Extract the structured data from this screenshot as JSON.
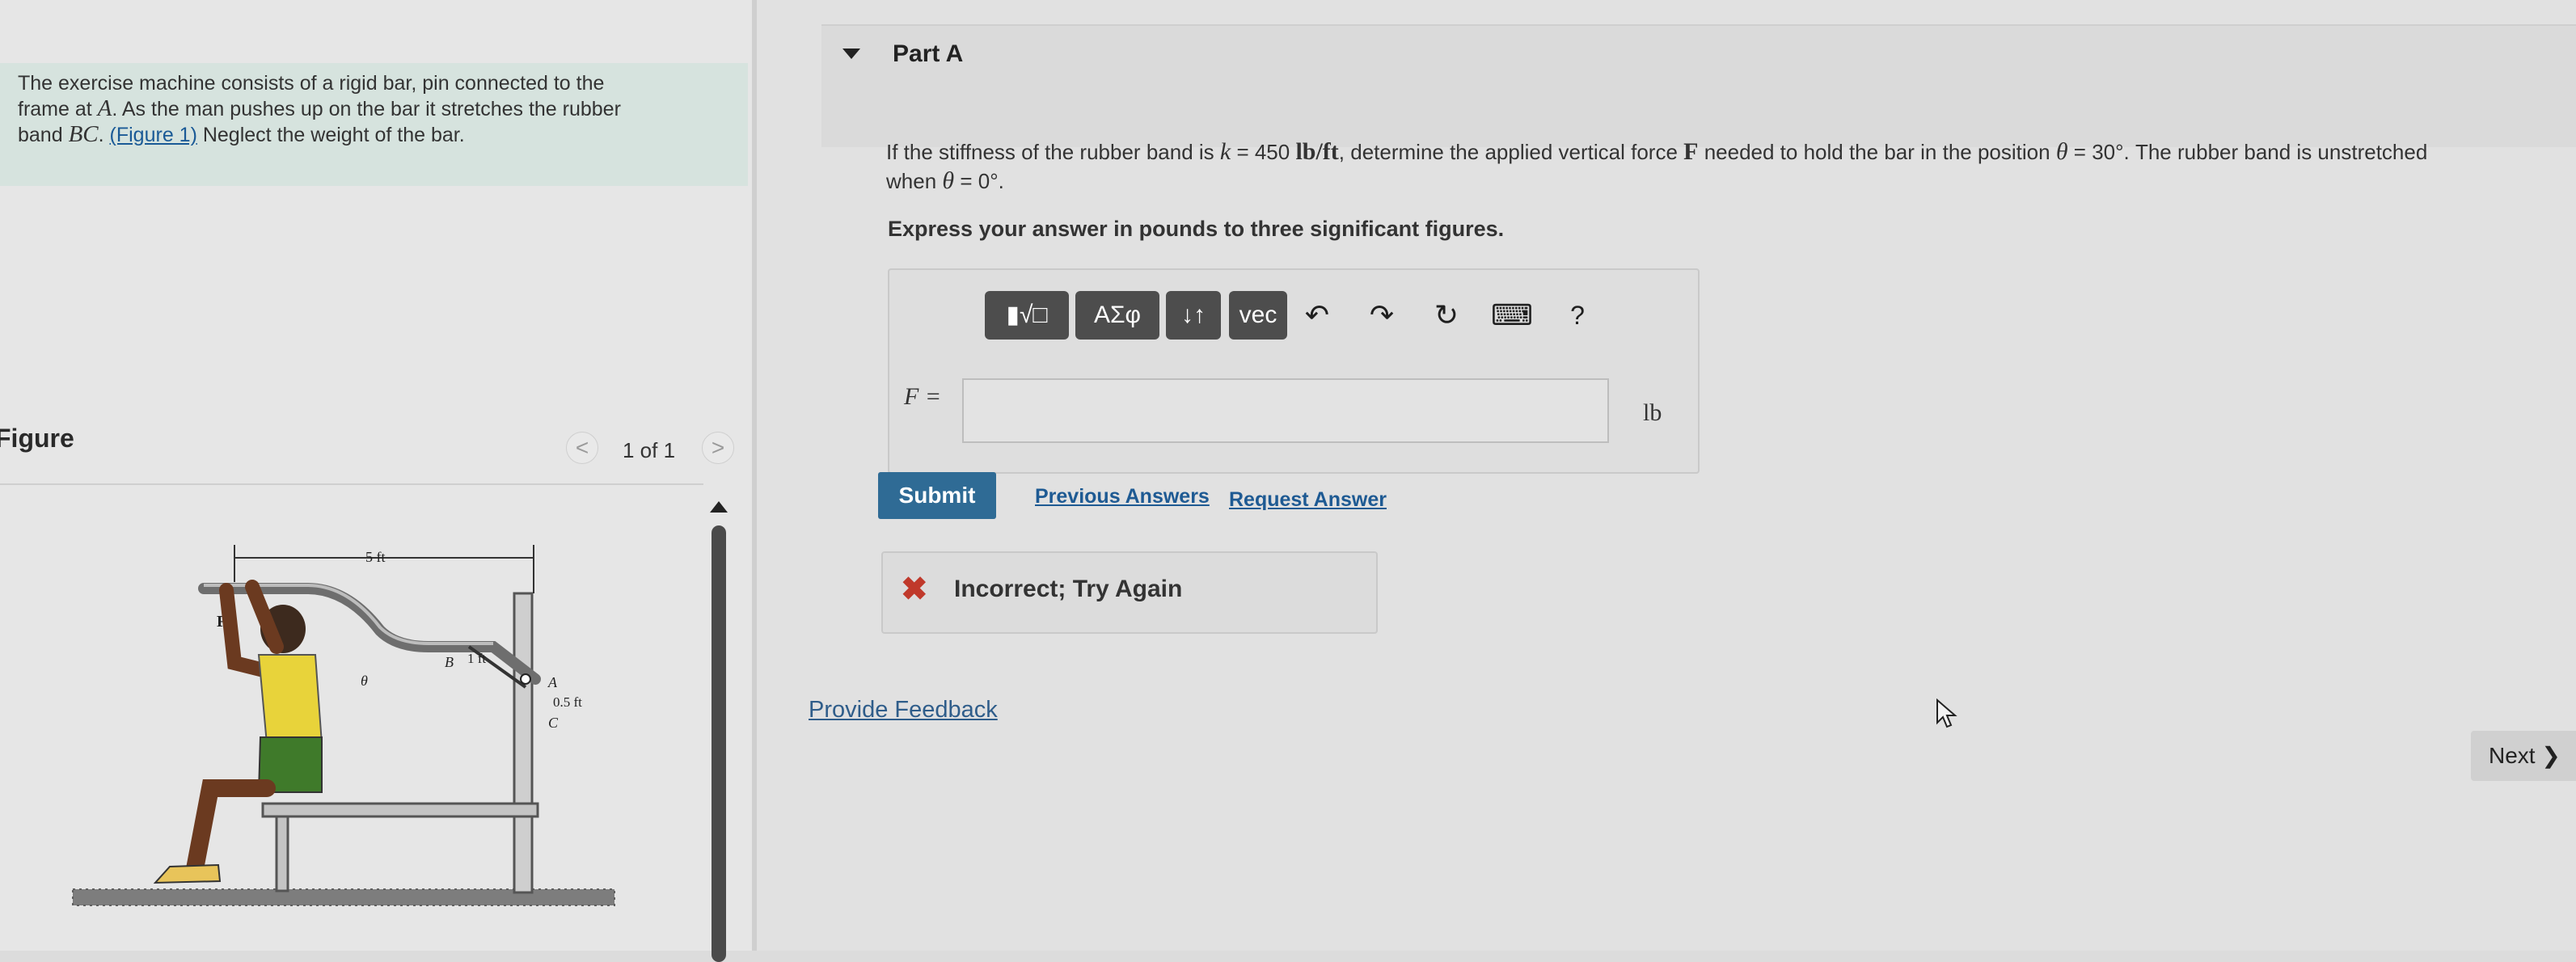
{
  "problem": {
    "text_1": "The exercise machine consists of a rigid bar, pin connected to the",
    "text_2a": "frame at ",
    "var_a": "A",
    "text_2b": ". As the man pushes up on the bar it stretches the rubber",
    "text_3a": "band ",
    "var_bc": "BC",
    "text_3b": ". ",
    "figure_link": "(Figure 1)",
    "text_3c": " Neglect the weight of the bar."
  },
  "figure_panel": {
    "title": "Figure",
    "pager": "1 of 1",
    "prev_icon": "<",
    "next_icon": ">",
    "labels": {
      "width": "5 ft",
      "force": "F",
      "theta": "θ",
      "b": "B",
      "b_dist": "1 ft",
      "a": "A",
      "c": "C",
      "ac_dist": "0.5 ft"
    }
  },
  "part": {
    "title": "Part A",
    "question_1a": "If the stiffness of the rubber band is ",
    "k_var": "k",
    "k_value": " = 450 ",
    "k_unit": "lb/ft",
    "question_1b": ", determine the applied vertical force ",
    "force_var": "F",
    "question_1c": " needed to hold the bar in the position ",
    "theta_var": "θ",
    "theta_value": " = 30°",
    "question_1d": ". The rubber band is unstretched",
    "question_2a": "when ",
    "question_2b": " = 0°",
    "question_2c": ".",
    "instruction": "Express your answer in pounds to three significant figures."
  },
  "toolbar": {
    "templates_label": "▮√□",
    "symbols_label": "ΑΣφ",
    "updown_label": "↓↑",
    "vec_label": "vec",
    "undo_icon": "↶",
    "redo_icon": "↷",
    "reset_icon": "↻",
    "keyboard_icon": "⌨",
    "help_label": "?"
  },
  "answer": {
    "label": "F =",
    "value": "",
    "unit": "lb"
  },
  "actions": {
    "submit": "Submit",
    "previous_answers": "Previous Answers",
    "request_answer": "Request Answer"
  },
  "feedback": {
    "icon": "✖",
    "message": "Incorrect; Try Again"
  },
  "provide_feedback": "Provide Feedback",
  "next": "Next ❯",
  "colors": {
    "submit_bg": "#2f6b95",
    "link": "#1e5a93",
    "error": "#c0392b",
    "problem_bg": "#d6e3de"
  }
}
